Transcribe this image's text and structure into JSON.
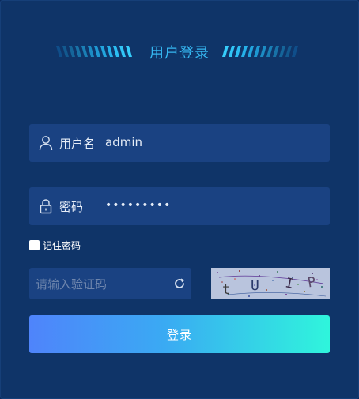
{
  "header": {
    "title": "用户登录"
  },
  "username": {
    "label": "用户名",
    "value": "admin",
    "icon": "user-icon"
  },
  "password": {
    "label": "密码",
    "value": "•••••••••",
    "icon": "lock-icon"
  },
  "remember": {
    "label": "记住密码",
    "checked": false
  },
  "captcha": {
    "placeholder": "请输入验证码",
    "refresh_icon": "refresh-icon",
    "image_text": "t U I P"
  },
  "login_button": {
    "label": "登录"
  },
  "colors": {
    "background": "#0f3468",
    "field": "#1a4282",
    "title": "#36b8f2",
    "button_start": "#4f84fb",
    "button_end": "#2ff5dc"
  }
}
